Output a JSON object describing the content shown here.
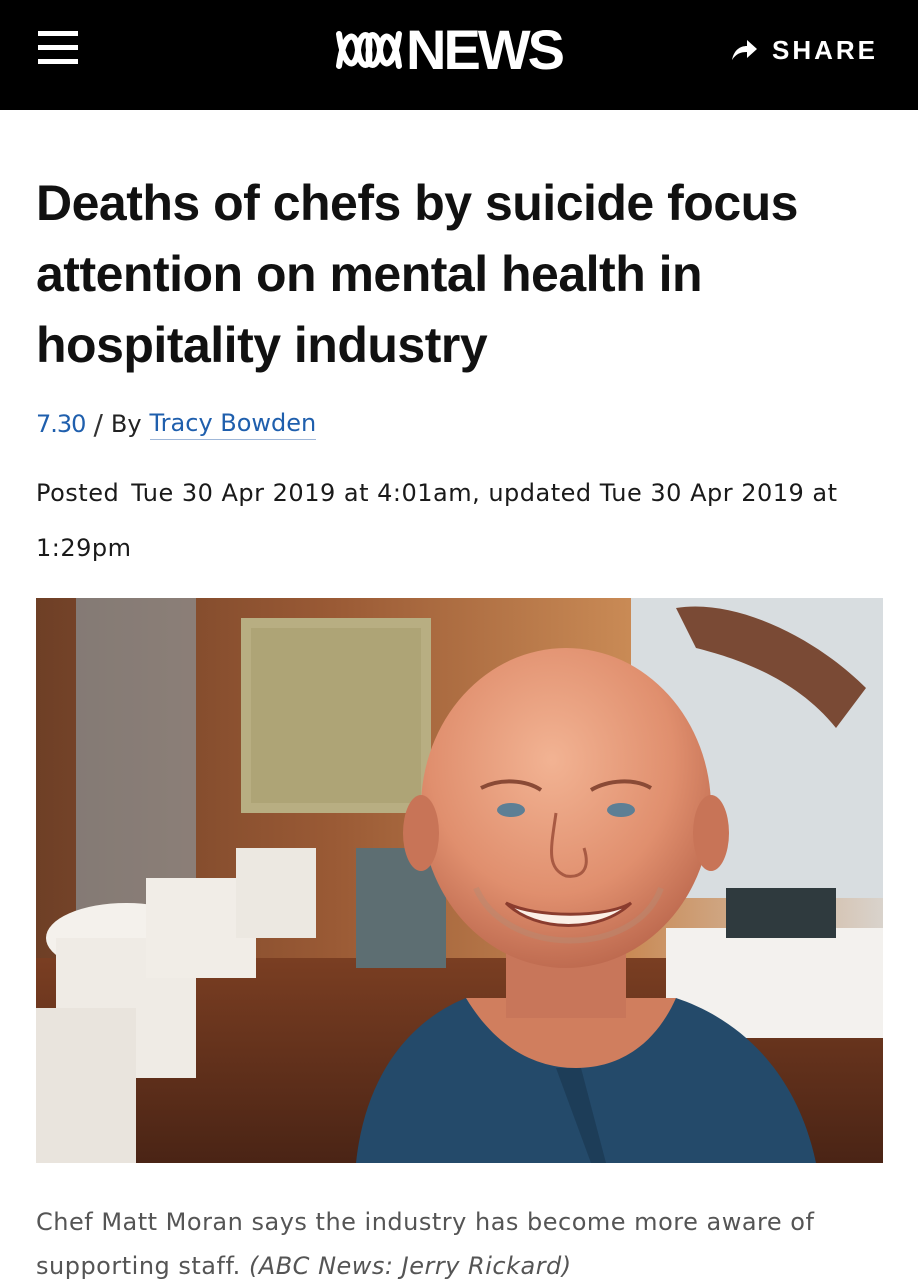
{
  "header": {
    "menu_icon": "hamburger-menu-icon",
    "logo_icon": "abc-lissajous-logo-icon",
    "logo_text": "NEWS",
    "share_icon": "share-arrow-icon",
    "share_label": "SHARE"
  },
  "article": {
    "headline": "Deaths of chefs by suicide focus attention on mental health in hospitality industry",
    "program": "7.30",
    "separator": "/",
    "by": "By",
    "author": "Tracy Bowden",
    "posted_label": "Posted",
    "posted_text": "Tue 30 Apr 2019 at 4:01am, updated Tue 30 Apr 2019 at 1:29pm"
  },
  "photo": {
    "caption": "Chef Matt Moran says the industry has become more aware of supporting staff.",
    "credit": "(ABC News: Jerry Rickard)"
  },
  "colors": {
    "header_bg": "#000000",
    "link": "#1f5fad",
    "caption": "#555555"
  }
}
